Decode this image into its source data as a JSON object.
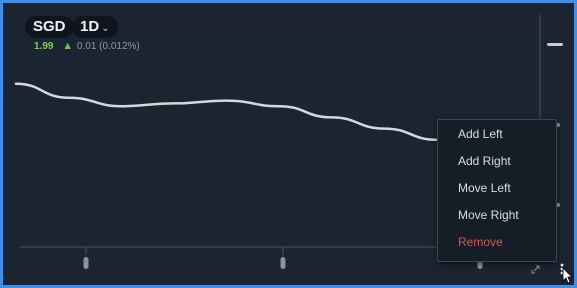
{
  "header": {
    "symbol": "SGD",
    "timeframe": "1D",
    "timeframe_chevron": "⌄",
    "price": "1.99",
    "change_icon": "up-arrow-icon",
    "change": "0.01 (0.012%)"
  },
  "chart_data": {
    "type": "line",
    "title": "",
    "xlabel": "",
    "ylabel": "",
    "grid": false,
    "series": [
      {
        "values": [
          1.984,
          1.979,
          1.976,
          1.977,
          1.978,
          1.976,
          1.972,
          1.968,
          1.964
        ]
      }
    ]
  },
  "context_menu": {
    "items": [
      {
        "label": "Add Left",
        "kind": "normal"
      },
      {
        "label": "Add Right",
        "kind": "normal"
      },
      {
        "label": "Move Left",
        "kind": "normal"
      },
      {
        "label": "Move Right",
        "kind": "normal"
      },
      {
        "label": "Remove",
        "kind": "danger"
      }
    ]
  },
  "colors": {
    "frame_border": "#3d8fe8",
    "background": "#1b2531",
    "line": "#d6d8da",
    "positive": "#7ccf45",
    "danger": "#d9535b"
  }
}
